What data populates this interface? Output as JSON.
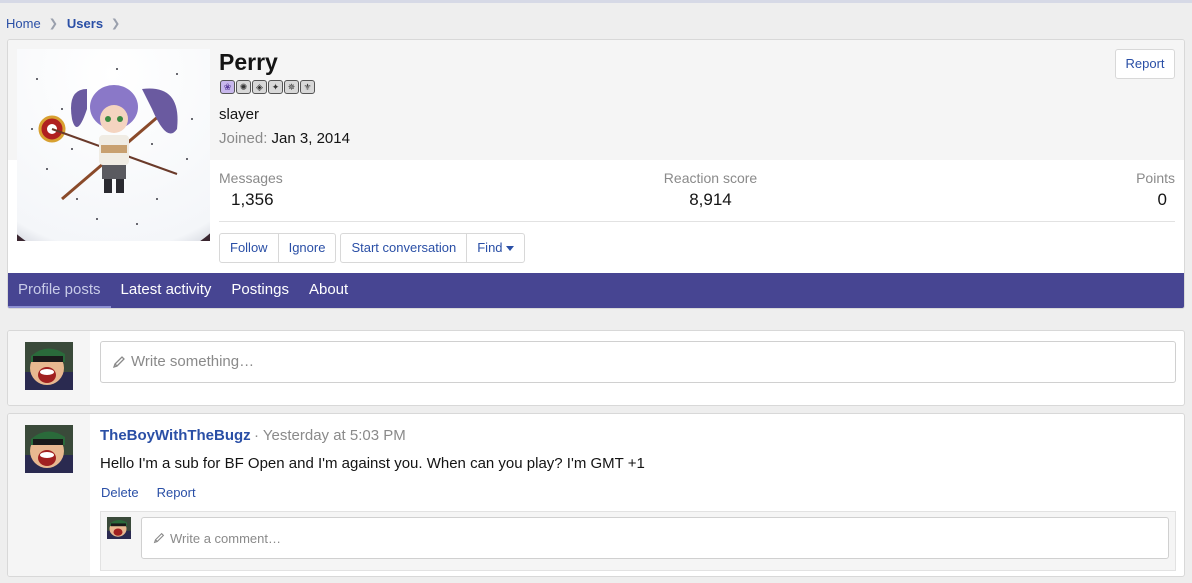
{
  "breadcrumb": {
    "items": [
      {
        "label": "Home"
      },
      {
        "label": "Users"
      }
    ]
  },
  "profile": {
    "name": "Perry",
    "title": "slayer",
    "joined_label": "Joined:",
    "joined_value": "Jan 3, 2014",
    "report_label": "Report",
    "stats": [
      {
        "label": "Messages",
        "value": "1,356"
      },
      {
        "label": "Reaction score",
        "value": "8,914"
      },
      {
        "label": "Points",
        "value": "0"
      }
    ],
    "buttons": {
      "follow": "Follow",
      "ignore": "Ignore",
      "start_conversation": "Start conversation",
      "find": "Find"
    },
    "badge_count": 6
  },
  "tabs": [
    {
      "label": "Profile posts",
      "active": true
    },
    {
      "label": "Latest activity",
      "active": false
    },
    {
      "label": "Postings",
      "active": false
    },
    {
      "label": "About",
      "active": false
    }
  ],
  "composer": {
    "placeholder": "Write something…"
  },
  "post": {
    "author": "TheBoyWithTheBugz",
    "time": "· Yesterday at 5:03 PM",
    "text": "Hello I'm a sub for BF Open and I'm against you. When can you play? I'm GMT +1",
    "actions": {
      "delete": "Delete",
      "report": "Report"
    },
    "comment_placeholder": "Write a comment…"
  },
  "colors": {
    "accent": "#474592",
    "link": "#2a4fa6",
    "tab_active": "#8c8fd2"
  }
}
